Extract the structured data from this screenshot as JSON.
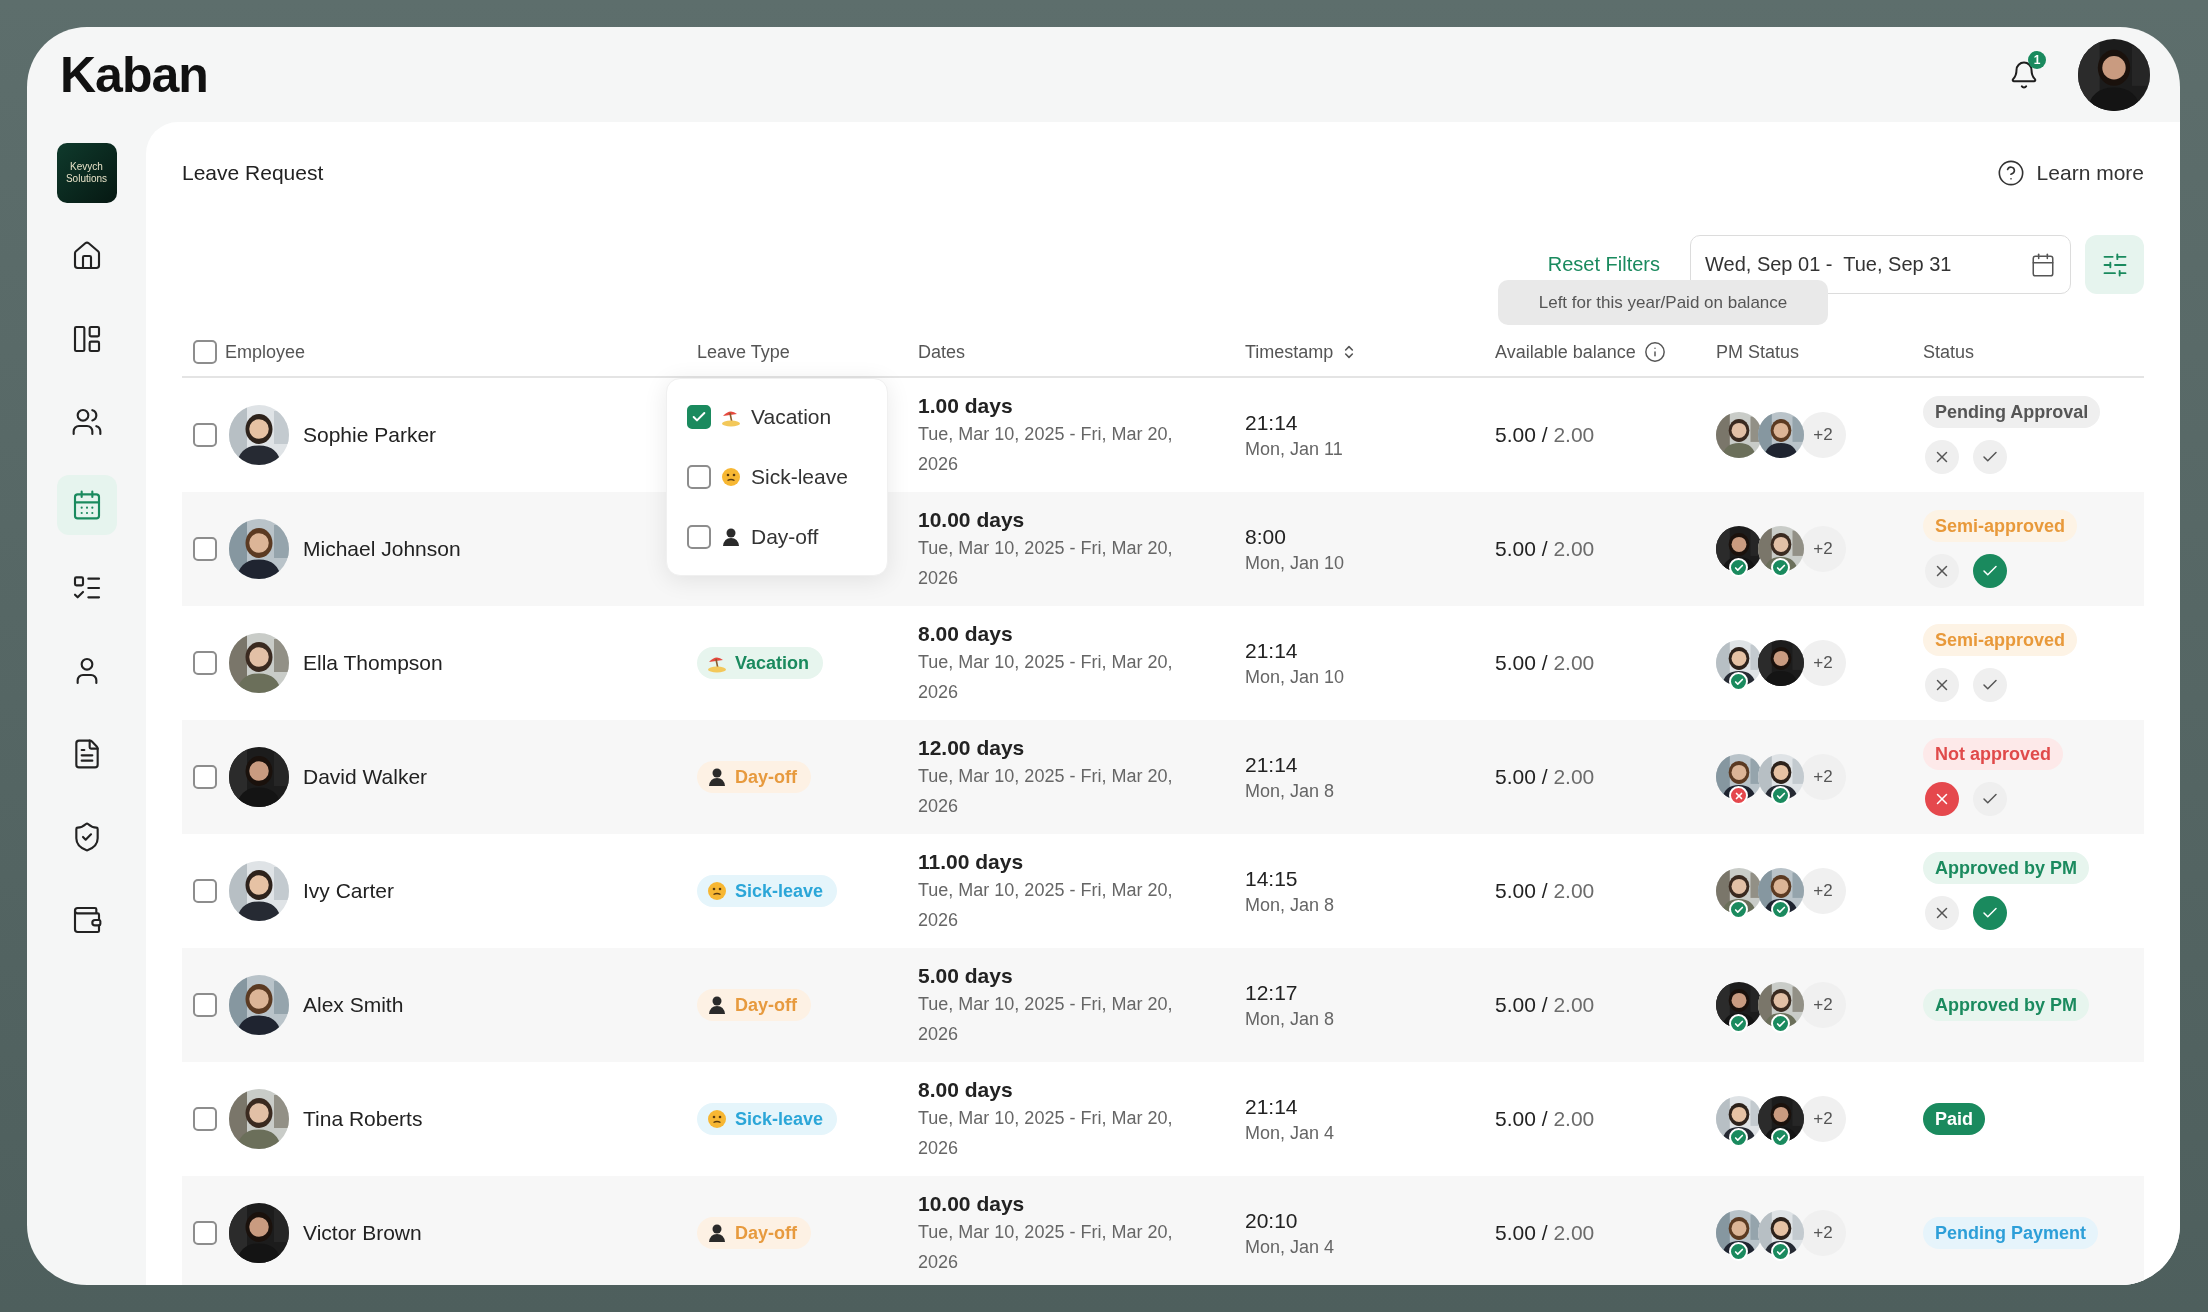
{
  "logo": "Kaban",
  "notifications": {
    "count": "1"
  },
  "sidebar": {
    "company": "Kevych Solutions",
    "items": [
      {
        "selected": false
      },
      {
        "selected": false
      },
      {
        "selected": false
      },
      {
        "selected": true
      },
      {
        "selected": false
      },
      {
        "selected": false
      },
      {
        "selected": false
      },
      {
        "selected": false
      },
      {
        "selected": false
      }
    ]
  },
  "page": {
    "title": "Leave Request",
    "learn_more": "Learn more"
  },
  "filters": {
    "reset": "Reset Filters",
    "date_range": "Wed, Sep 01 -  Tue, Sep 31"
  },
  "tooltip": "Left for this year/Paid on balance",
  "leave_type_menu": [
    {
      "label": "Vacation",
      "kind": "vacation",
      "checked": true
    },
    {
      "label": "Sick-leave",
      "kind": "sick",
      "checked": false
    },
    {
      "label": "Day-off",
      "kind": "dayoff",
      "checked": false
    }
  ],
  "table": {
    "select_all_checked": false,
    "columns": [
      {
        "label": "Employee"
      },
      {
        "label": "Leave Type"
      },
      {
        "label": "Dates"
      },
      {
        "label": "Timestamp",
        "sortable": true
      },
      {
        "label": "Available balance",
        "info": true
      },
      {
        "label": "PM Status"
      },
      {
        "label": "Status"
      }
    ],
    "rows": [
      {
        "name": "Sophie Parker",
        "checked": false,
        "days": "1.00 days",
        "range": "Tue, Mar 10, 2025 - Fri, Mar 20, 2026",
        "time": "21:14",
        "date": "Mon, Jan 11",
        "balance_used": "5.00 /",
        "balance_total": "2.00",
        "pm": [
          {
            "kind": "none"
          },
          {
            "kind": "none"
          }
        ],
        "pm_more": "+2",
        "status": {
          "label": "Pending Approval",
          "kind": "pending"
        },
        "actions": {
          "rejected": false,
          "approved": false
        }
      },
      {
        "name": "Michael Johnson",
        "checked": false,
        "days": "10.00 days",
        "range": "Tue, Mar 10, 2025 - Fri, Mar 20, 2026",
        "time": "8:00",
        "date": "Mon, Jan 10",
        "balance_used": "5.00 /",
        "balance_total": "2.00",
        "pm": [
          {
            "kind": "approved"
          },
          {
            "kind": "approved"
          }
        ],
        "pm_more": "+2",
        "status": {
          "label": "Semi-approved",
          "kind": "semi"
        },
        "actions": {
          "rejected": false,
          "approved": true
        }
      },
      {
        "name": "Ella Thompson",
        "checked": false,
        "leave_type": {
          "label": "Vacation",
          "kind": "vacation"
        },
        "days": "8.00 days",
        "range": "Tue, Mar 10, 2025 - Fri, Mar 20, 2026",
        "time": "21:14",
        "date": "Mon, Jan 10",
        "balance_used": "5.00 /",
        "balance_total": "2.00",
        "pm": [
          {
            "kind": "approved"
          },
          {
            "kind": "none"
          }
        ],
        "pm_more": "+2",
        "status": {
          "label": "Semi-approved",
          "kind": "semi"
        },
        "actions": {
          "rejected": false,
          "approved": false
        }
      },
      {
        "name": "David Walker",
        "checked": false,
        "leave_type": {
          "label": "Day-off",
          "kind": "dayoff"
        },
        "days": "12.00 days",
        "range": "Tue, Mar 10, 2025 - Fri, Mar 20, 2026",
        "time": "21:14",
        "date": "Mon, Jan 8",
        "balance_used": "5.00 /",
        "balance_total": "2.00",
        "pm": [
          {
            "kind": "rejected"
          },
          {
            "kind": "approved"
          }
        ],
        "pm_more": "+2",
        "status": {
          "label": "Not approved",
          "kind": "rejected"
        },
        "actions": {
          "rejected": true,
          "approved": false
        }
      },
      {
        "name": "Ivy Carter",
        "checked": false,
        "leave_type": {
          "label": "Sick-leave",
          "kind": "sick"
        },
        "days": "11.00 days",
        "range": "Tue, Mar 10, 2025 - Fri, Mar 20, 2026",
        "time": "14:15",
        "date": "Mon, Jan 8",
        "balance_used": "5.00 /",
        "balance_total": "2.00",
        "pm": [
          {
            "kind": "approved"
          },
          {
            "kind": "approved"
          }
        ],
        "pm_more": "+2",
        "status": {
          "label": "Approved by PM",
          "kind": "approved"
        },
        "actions": {
          "rejected": false,
          "approved": true
        }
      },
      {
        "name": "Alex Smith",
        "checked": false,
        "leave_type": {
          "label": "Day-off",
          "kind": "dayoff"
        },
        "days": "5.00 days",
        "range": "Tue, Mar 10, 2025 - Fri, Mar 20, 2026",
        "time": "12:17",
        "date": "Mon, Jan 8",
        "balance_used": "5.00 /",
        "balance_total": "2.00",
        "pm": [
          {
            "kind": "approved"
          },
          {
            "kind": "approved"
          }
        ],
        "pm_more": "+2",
        "status": {
          "label": "Approved by PM",
          "kind": "approved"
        }
      },
      {
        "name": "Tina Roberts",
        "checked": false,
        "leave_type": {
          "label": "Sick-leave",
          "kind": "sick"
        },
        "days": "8.00 days",
        "range": "Tue, Mar 10, 2025 - Fri, Mar 20, 2026",
        "time": "21:14",
        "date": "Mon, Jan 4",
        "balance_used": "5.00 /",
        "balance_total": "2.00",
        "pm": [
          {
            "kind": "approved"
          },
          {
            "kind": "approved"
          }
        ],
        "pm_more": "+2",
        "status": {
          "label": "Paid",
          "kind": "paid"
        }
      },
      {
        "name": "Victor Brown",
        "checked": false,
        "leave_type": {
          "label": "Day-off",
          "kind": "dayoff"
        },
        "days": "10.00 days",
        "range": "Tue, Mar 10, 2025 - Fri, Mar 20, 2026",
        "time": "20:10",
        "date": "Mon, Jan 4",
        "balance_used": "5.00 /",
        "balance_total": "2.00",
        "pm": [
          {
            "kind": "approved"
          },
          {
            "kind": "approved"
          }
        ],
        "pm_more": "+2",
        "status": {
          "label": "Pending Payment",
          "kind": "payment"
        }
      }
    ]
  }
}
